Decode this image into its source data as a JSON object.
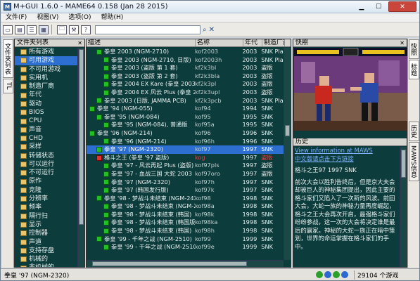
{
  "window": {
    "title": "M+GUI 1.6.0 - MAME64 0.158 (Jan 28 2015)",
    "app_icon_text": "M"
  },
  "menu": [
    "文件(F)",
    "视图(V)",
    "选项(O)",
    "帮助(H)"
  ],
  "left_tabs": [
    "文件夹列表",
    "TL"
  ],
  "folder_pane": {
    "header": "文件夹列表",
    "items": [
      "所有游戏",
      "可用游戏",
      "不可用游戏",
      "实用机",
      "制造厂商",
      "年代",
      "驱动",
      "BIOS",
      "CPU",
      "声音",
      "CHD",
      "采样",
      "转储状态",
      "可以运行",
      "不可运行",
      "原作",
      "克隆",
      "分辨率",
      "频率",
      "隔行扫",
      "显示",
      "控制器",
      "声道",
      "支持存盘",
      "机械的",
      "非机械的",
      "CS-History"
    ],
    "selected_index": 1
  },
  "columns": [
    "描述",
    "名称",
    "年代",
    "制造厂商"
  ],
  "games": [
    {
      "desc": "拳皇 2003 (NGM-2710)",
      "name": "kof2003",
      "year": "2003",
      "mfr": "SNK Playm",
      "indent": 1,
      "icon": "green"
    },
    {
      "desc": "拳皇 2003 (NGM-2710, 日版)",
      "name": "kof2003h",
      "year": "2003",
      "mfr": "SNK Playm",
      "indent": 2,
      "icon": "green"
    },
    {
      "desc": "拳皇 2003 (盗版 第 1 套)",
      "name": "kf2k3bl",
      "year": "2003",
      "mfr": "盗版",
      "indent": 2,
      "icon": "green"
    },
    {
      "desc": "拳皇 2003 (盗版 第 2 套)",
      "name": "kf2k3bla",
      "year": "2003",
      "mfr": "盗版",
      "indent": 2,
      "icon": "green"
    },
    {
      "desc": "拳皇 2004 EX Kare (拳皇 2003 盗版)",
      "name": "kf2k3pl",
      "year": "2003",
      "mfr": "盗版",
      "indent": 2,
      "icon": "green"
    },
    {
      "desc": "拳皇 2004 EX 风云 Plus (拳皇 2003 盗版)",
      "name": "kf2k3upl",
      "year": "2003",
      "mfr": "盗版",
      "indent": 2,
      "icon": "green"
    },
    {
      "desc": "拳皇 2003 (日版, JAMMA PCB)",
      "name": "kf2k3pcb",
      "year": "2003",
      "mfr": "SNK Playm",
      "indent": 1,
      "icon": "green"
    },
    {
      "desc": "拳皇 '94 (NGM-055)",
      "name": "kof94",
      "year": "1994",
      "mfr": "SNK",
      "indent": 0,
      "icon": "green"
    },
    {
      "desc": "拳皇 '95 (NGM-084)",
      "name": "kof95",
      "year": "1995",
      "mfr": "SNK",
      "indent": 1,
      "icon": "green"
    },
    {
      "desc": "拳皇 '95 (NGM-084), 普通版",
      "name": "kof95a",
      "year": "1995",
      "mfr": "SNK",
      "indent": 2,
      "icon": "green"
    },
    {
      "desc": "拳皇 '96 (NGM-214)",
      "name": "kof96",
      "year": "1996",
      "mfr": "SNK",
      "indent": 0,
      "icon": "green"
    },
    {
      "desc": "拳皇 '96 (NGM-214)",
      "name": "kof96h",
      "year": "1996",
      "mfr": "SNK",
      "indent": 2,
      "icon": "green"
    },
    {
      "desc": "拳皇 '97 (NGM-2320)",
      "name": "kof97",
      "year": "1997",
      "mfr": "SNK",
      "indent": 1,
      "icon": "green",
      "selected": true
    },
    {
      "desc": "格斗之王 (拳皇 '97 盗版)",
      "name": "kog",
      "year": "1997",
      "mfr": "盗版",
      "indent": 1,
      "icon": "red",
      "red": true
    },
    {
      "desc": "拳皇 '97 - 风云再起 Plus (盗版)",
      "name": "kof97pls",
      "year": "1997",
      "mfr": "盗版",
      "indent": 2,
      "icon": "green"
    },
    {
      "desc": "拳皇 '97 - 血战三国 大蛇 2003",
      "name": "kof97oro",
      "year": "1997",
      "mfr": "盗版",
      "indent": 2,
      "icon": "green"
    },
    {
      "desc": "拳皇 '97 (NGM-2320)",
      "name": "kof97h",
      "year": "1997",
      "mfr": "SNK",
      "indent": 2,
      "icon": "green"
    },
    {
      "desc": "拳皇 '97 (韩国发行版)",
      "name": "kof97k",
      "year": "1997",
      "mfr": "SNK",
      "indent": 2,
      "icon": "green"
    },
    {
      "desc": "拳皇 '98 - 梦战斗未结束 (NGM-2420)",
      "name": "kof98",
      "year": "1998",
      "mfr": "SNK",
      "indent": 1,
      "icon": "green"
    },
    {
      "desc": "拳皇 '98 - 梦战斗未结束 (NGM-2420)",
      "name": "kof98a",
      "year": "1998",
      "mfr": "SNK",
      "indent": 2,
      "icon": "green"
    },
    {
      "desc": "拳皇 '98 - 梦战斗未结束 (韩国)",
      "name": "kof98k",
      "year": "1998",
      "mfr": "SNK",
      "indent": 2,
      "icon": "green"
    },
    {
      "desc": "拳皇 '98 - 梦战斗未结束 (韩国版)",
      "name": "kof98ka",
      "year": "1998",
      "mfr": "SNK",
      "indent": 2,
      "icon": "green"
    },
    {
      "desc": "拳皇 '98 - 梦战斗未结束 (韩国)",
      "name": "kof98h",
      "year": "1998",
      "mfr": "SNK",
      "indent": 2,
      "icon": "green"
    },
    {
      "desc": "拳皇 '99 - 千年之战 (NGM-2510)",
      "name": "kof99",
      "year": "1999",
      "mfr": "SNK",
      "indent": 1,
      "icon": "green"
    },
    {
      "desc": "拳皇 '99 - 千年之战 (NGM-2510)",
      "name": "kof99e",
      "year": "1999",
      "mfr": "SNK",
      "indent": 2,
      "icon": "green"
    }
  ],
  "snapshot": {
    "header": "快照"
  },
  "history": {
    "header": "历史",
    "link1": "View information at MAWS",
    "link2": "中文版请点击下方链接",
    "title": "格斗之王97 1997 SNK",
    "body": "前次大会以胜利告终后，但是京大夫会却被巨人的神秘集团提出，因此主要的格斗家们又陷入了一次新的风波。前回大会，大蛇一族的神秘力量再度崛起，格斗之王大会再次开启，最强格斗家们纷纷参战，这一次的大会将决定谁是最后的赢家。神秘的大蛇一族正在暗中策划，世界的命运掌握在格斗家们的手中。"
  },
  "right_tabs": [
    "快照",
    "标题",
    "历史",
    "MAWS信息"
  ],
  "status": {
    "selected": "拳皇 '97 (NGM-2320)",
    "count": "29104 个游戏"
  }
}
